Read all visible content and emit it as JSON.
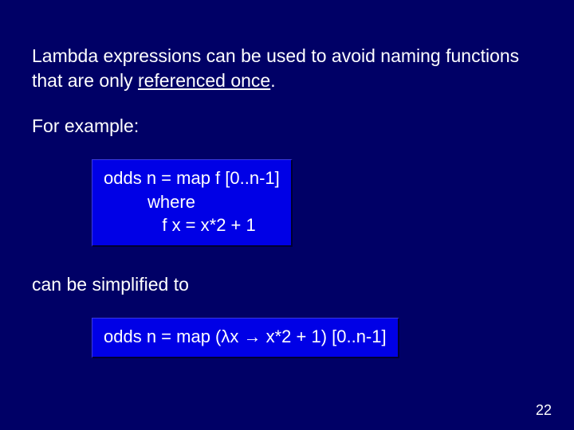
{
  "intro": {
    "part1": "Lambda expressions can be used to avoid naming functions that are only ",
    "underlined": "referenced once",
    "part2": "."
  },
  "for_example": "For example:",
  "code1": {
    "line1": "odds n = map f [0..n-1]",
    "line2": "         where",
    "line3": "            f x = x*2 + 1"
  },
  "simplified_label": "can be simplified to",
  "code2": {
    "line1": "odds n = map (λx → x*2 + 1) [0..n-1]"
  },
  "page_number": "22"
}
